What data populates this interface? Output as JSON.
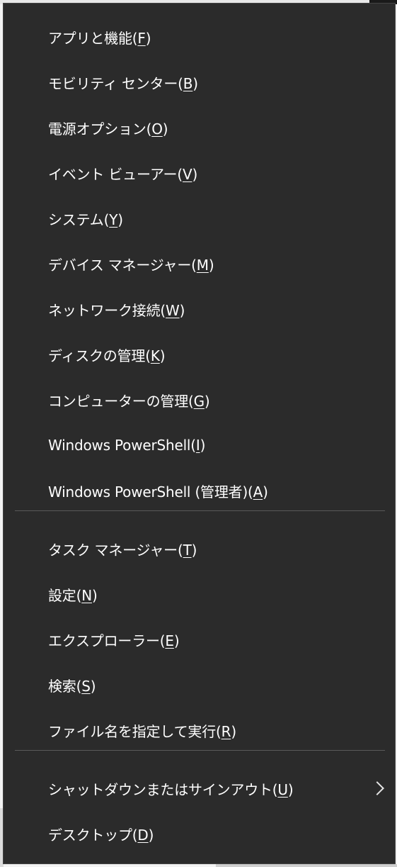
{
  "menu": {
    "groups": [
      [
        {
          "label": "アプリと機能(",
          "key": "F",
          "suffix": ")"
        },
        {
          "label": "モビリティ センター(",
          "key": "B",
          "suffix": ")"
        },
        {
          "label": "電源オプション(",
          "key": "O",
          "suffix": ")"
        },
        {
          "label": "イベント ビューアー(",
          "key": "V",
          "suffix": ")"
        },
        {
          "label": "システム(",
          "key": "Y",
          "suffix": ")"
        },
        {
          "label": "デバイス マネージャー(",
          "key": "M",
          "suffix": ")"
        },
        {
          "label": "ネットワーク接続(",
          "key": "W",
          "suffix": ")"
        },
        {
          "label": "ディスクの管理(",
          "key": "K",
          "suffix": ")"
        },
        {
          "label": "コンピューターの管理(",
          "key": "G",
          "suffix": ")"
        },
        {
          "label": "Windows PowerShell(",
          "key": "I",
          "suffix": ")"
        },
        {
          "label": "Windows PowerShell (管理者)(",
          "key": "A",
          "suffix": ")"
        }
      ],
      [
        {
          "label": "タスク マネージャー(",
          "key": "T",
          "suffix": ")"
        },
        {
          "label": "設定(",
          "key": "N",
          "suffix": ")"
        },
        {
          "label": "エクスプローラー(",
          "key": "E",
          "suffix": ")"
        },
        {
          "label": "検索(",
          "key": "S",
          "suffix": ")"
        },
        {
          "label": "ファイル名を指定して実行(",
          "key": "R",
          "suffix": ")"
        }
      ],
      [
        {
          "label": "シャットダウンまたはサインアウト(",
          "key": "U",
          "suffix": ")",
          "submenu": true,
          "icon": "chevron-right-icon"
        },
        {
          "label": "デスクトップ(",
          "key": "D",
          "suffix": ")"
        }
      ]
    ]
  },
  "colors": {
    "menu_bg": "#2b2b2b",
    "text": "#ffffff",
    "separator": "#5a5a5a"
  }
}
